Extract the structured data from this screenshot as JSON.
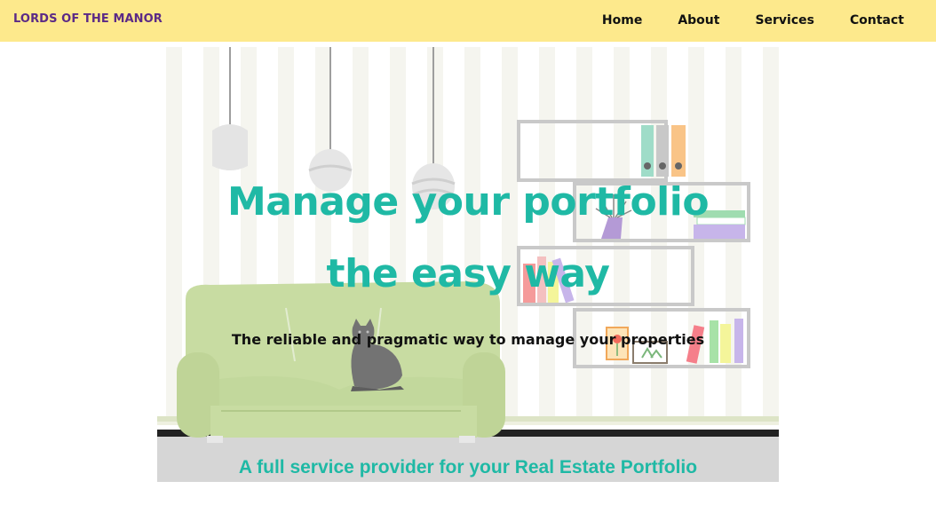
{
  "navbar": {
    "brand": "LORDS OF THE MANOR",
    "links": [
      "Home",
      "About",
      "Services",
      "Contact"
    ],
    "background_color": "#fde98c",
    "brand_color": "#5b2a86"
  },
  "hero": {
    "title_line1": "Manage your portfolio",
    "title_line2": "the easy way",
    "subtitle": "The reliable and pragmatic way to manage your properties",
    "tagline": "A full service provider for your Real Estate Portfolio",
    "accent_color": "#1fb9a5",
    "illustration": {
      "icons": [
        "pendant-lamp-icon",
        "sofa-icon",
        "cat-icon",
        "bookshelf-icon",
        "binder-icon",
        "plant-icon",
        "book-stack-icon",
        "picture-frame-icon"
      ]
    }
  }
}
